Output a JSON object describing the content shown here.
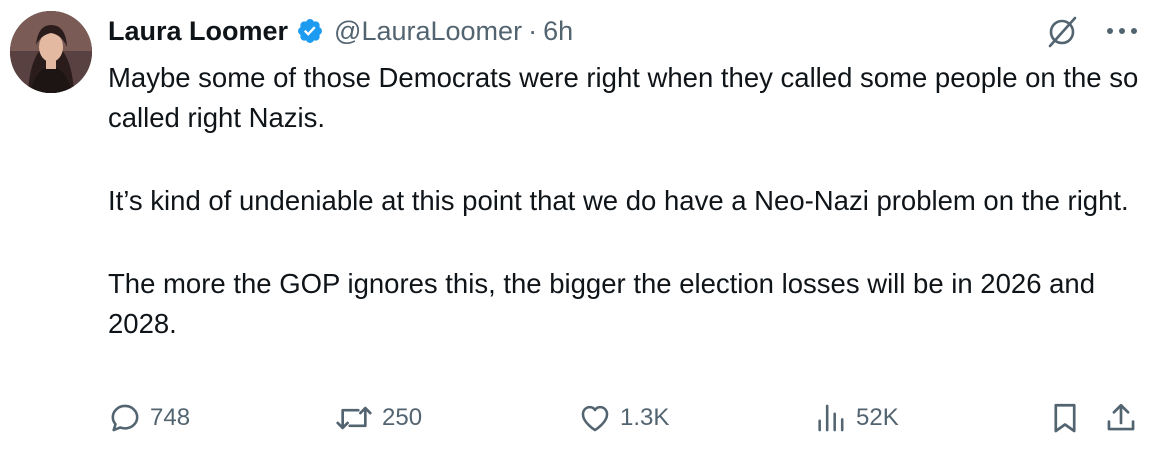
{
  "author": {
    "name": "Laura Loomer",
    "handle": "@LauraLoomer",
    "separator": "·",
    "time": "6h"
  },
  "tweet": {
    "paragraphs": [
      "Maybe some of those Democrats were right when they called some people on the so called right Nazis.",
      "It’s kind of undeniable at this point that we do have a Neo-Nazi problem on the right.",
      "The more the GOP ignores this, the bigger the election losses will be in 2026 and 2028."
    ]
  },
  "stats": {
    "replies": "748",
    "reposts": "250",
    "likes": "1.3K",
    "views": "52K"
  },
  "colors": {
    "verified": "#1d9bf0",
    "secondary_text": "#536471",
    "primary_text": "#0f1419"
  },
  "icons": [
    "verified-badge-icon",
    "grok-icon",
    "more-icon",
    "reply-icon",
    "repost-icon",
    "like-icon",
    "views-icon",
    "bookmark-icon",
    "share-icon"
  ]
}
